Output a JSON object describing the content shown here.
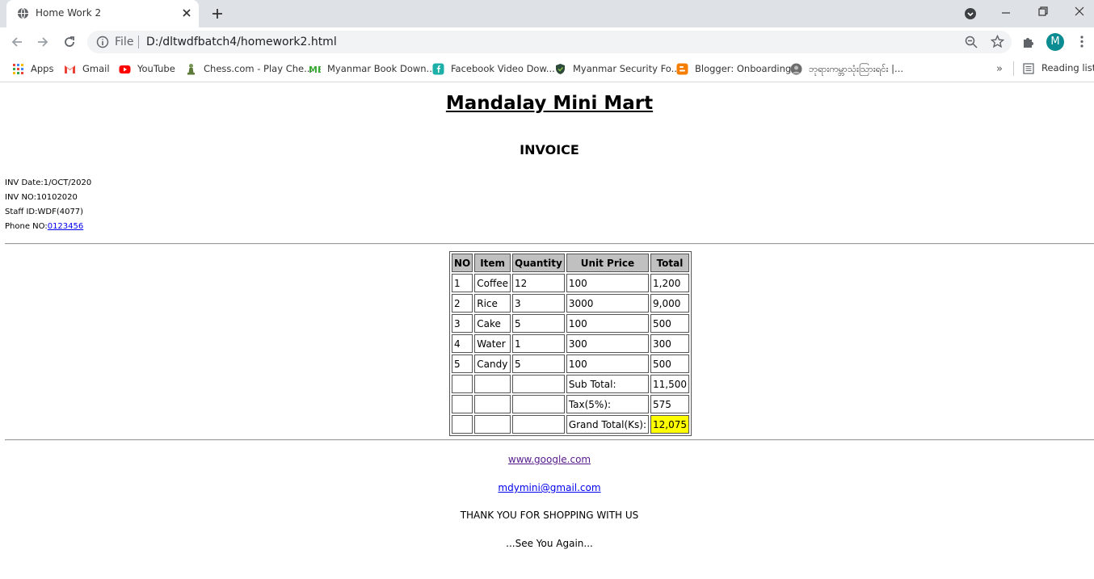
{
  "browser": {
    "tab_title": "Home Work 2",
    "address_scheme": "File",
    "address_url": "D:/dltwdfbatch4/homework2.html",
    "avatar_initial": "M",
    "bookmarks": [
      {
        "label": "Apps",
        "icon": "apps-grid-icon"
      },
      {
        "label": "Gmail",
        "icon": "gmail-icon"
      },
      {
        "label": "YouTube",
        "icon": "youtube-icon"
      },
      {
        "label": "Chess.com - Play Che...",
        "icon": "chess-pawn-icon"
      },
      {
        "label": "Myanmar Book Down...",
        "icon": "mb-logo-icon"
      },
      {
        "label": "Facebook Video Dow...",
        "icon": "facebook-download-icon"
      },
      {
        "label": "Myanmar Security Fo...",
        "icon": "shield-icon"
      },
      {
        "label": "Blogger: Onboarding",
        "icon": "blogger-icon"
      },
      {
        "label": "ဘုရားကမ္ဘာသုံးသြားရင်း |...",
        "icon": "profile-photo-icon"
      }
    ],
    "reading_list": "Reading list",
    "overflow": "»"
  },
  "page": {
    "shop_name": "Mandalay Mini Mart",
    "heading": "INVOICE",
    "meta": {
      "date": "INV Date:1/OCT/2020",
      "number": "INV NO:10102020",
      "staff": "Staff ID:WDF(4077)",
      "phone_label": "Phone NO:",
      "phone_value": "0123456"
    },
    "table": {
      "headers": [
        "NO",
        "Item",
        "Quantity",
        "Unit Price",
        "Total"
      ],
      "rows": [
        [
          "1",
          "Coffee",
          "12",
          "100",
          "1,200"
        ],
        [
          "2",
          "Rice",
          "3",
          "3000",
          "9,000"
        ],
        [
          "3",
          "Cake",
          "5",
          "100",
          "500"
        ],
        [
          "4",
          "Water",
          "1",
          "300",
          "300"
        ],
        [
          "5",
          "Candy",
          "5",
          "100",
          "500"
        ]
      ],
      "subtotal_label": "Sub Total:",
      "subtotal_value": "11,500",
      "tax_label": "Tax(5%):",
      "tax_value": "575",
      "grand_label": "Grand Total(Ks):",
      "grand_value": "12,075",
      "highlight_color": "#ffff00"
    },
    "footer": {
      "link1": "www.google.com",
      "link2": "mdymini@gmail.com",
      "thanks": "THANK YOU FOR SHOPPING WITH US",
      "goodbye": "...See You Again..."
    }
  }
}
